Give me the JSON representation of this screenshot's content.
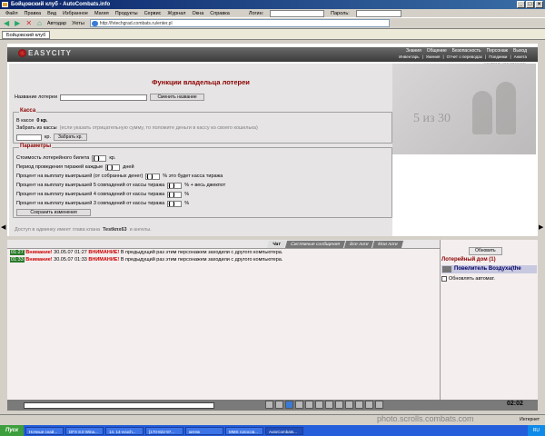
{
  "window": {
    "title": "Бойцовский клуб - AutoCombats.info"
  },
  "menu": {
    "items": [
      "Файл",
      "Правка",
      "Вид",
      "Избранное",
      "Магия",
      "Продукты",
      "Сервис",
      "Журнал",
      "Окна",
      "Справка"
    ],
    "login_label": "Логин:",
    "pass_label": "Пароль:"
  },
  "toolbar": {
    "autodar": "Автодар",
    "useful": "Уюты",
    "address": "http://fvtechgrad.combats.ru/enter.pl"
  },
  "tab": {
    "label": "Бойцовский клуб"
  },
  "site": {
    "logo": "EASYCITY",
    "nav1": [
      "Знания",
      "Общение",
      "Безопасность",
      "Персонаж",
      "Выход"
    ],
    "nav2": [
      "Инвентарь",
      "Умения",
      "Отчет о переводах",
      "Поединки",
      "Анкета"
    ],
    "location": "центральная площадь",
    "side_caption": "5 из 30"
  },
  "lottery": {
    "title": "Функции владельца лотереи",
    "name_label": "Название лотереи",
    "name_value": "",
    "name_button": "Сменить название",
    "cash_legend": "Касса",
    "cash_text_prefix": "В кассе",
    "cash_amount": "0 кр.",
    "withdraw_label": "Забрать из кассы",
    "withdraw_hint": "(если указать отрицательную сумму, то положите деньги в кассу из своего кошелька)",
    "withdraw_unit": "кр.",
    "withdraw_button": "Забрать кр.",
    "params_legend": "Параметры",
    "ticket_label": "Стоимость лотерейного билета",
    "ticket_value": "0",
    "ticket_unit": "кр.",
    "period_label": "Период проведения тиражей каждые",
    "period_value": "0",
    "period_unit": "дней",
    "p1_label": "Процент на выплату выигрышей (от собранных денег)",
    "p1_value": "0",
    "p1_suffix": "% это будет касса тиража",
    "p2_label": "Процент на выплату выигрышей 5 совпадений от кассы тиража",
    "p2_value": "0",
    "p2_suffix": "% + весь джекпот",
    "p3_label": "Процент на выплату выигрышей 4 совпадений от кассы тиража",
    "p3_value": "0",
    "p3_suffix": "%",
    "p4_label": "Процент на выплату выигрышей 3 совпадений от кассы тиража",
    "p4_value": "0",
    "p4_suffix": "%",
    "save_button": "Сохранить изменения",
    "access_prefix": "Доступ в админку имеет глава клана",
    "access_name": "Testknx63",
    "access_suffix": "и ангелы."
  },
  "chat": {
    "tabs": [
      "Чат",
      "Системные сообщения",
      "Все логи",
      "Мои логи"
    ],
    "messages": [
      {
        "ts": "01:27",
        "warn_label": "Внимание!",
        "date": "30.05.07 01:27",
        "warn2": "ВНИМАНИЕ!",
        "text": "В предыдущий раз этим персонажем заходили с другого компьютера."
      },
      {
        "ts": "01:33",
        "warn_label": "Внимание!",
        "date": "30.05.07 01:33",
        "warn2": "ВНИМАНИЕ!",
        "text": "В предыдущий раз этим персонажем заходили с другого компьютера."
      }
    ]
  },
  "right_panel": {
    "refresh_button": "Обновить",
    "room_title": "Лотерейный дом (1)",
    "user": "Повелитель Воздуха(the",
    "auto_label": "Обновлять автомат."
  },
  "bottom": {
    "clock": "02:02"
  },
  "watermark": "photo.scrolls.combats.com",
  "statusbar": {
    "left": "",
    "right": "Интернет"
  },
  "taskbar": {
    "start": "Пуск",
    "tasks": [
      "Ночные снай...",
      "DFX 8.0 Wina...",
      "14. 14-vvuch...",
      "[170-822-97...",
      "китеж",
      "MMS голосов...",
      "AutoCombats..."
    ],
    "tray": "RU"
  }
}
